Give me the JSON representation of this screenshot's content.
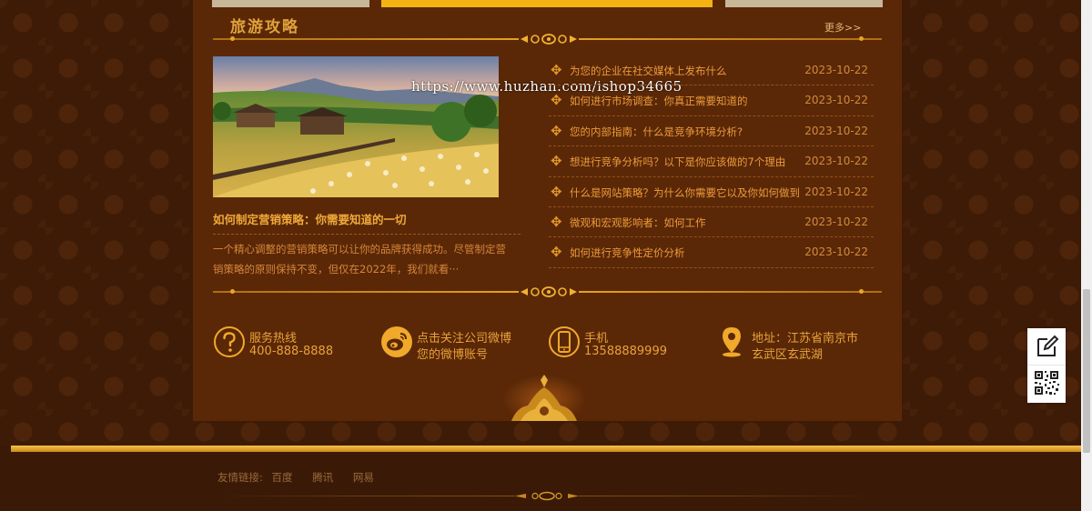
{
  "section": {
    "title": "旅游攻略",
    "more": "更多>>"
  },
  "featured": {
    "title": "如何制定营销策略：你需要知道的一切",
    "description": "一个精心调整的营销策略可以让你的品牌获得成功。尽管制定营销策略的原则保持不变，但仅在2022年，我们就看···",
    "watermark": "https://www.huzhan.com/ishop34665"
  },
  "news": [
    {
      "title": "为您的企业在社交媒体上发布什么",
      "date": "2023-10-22"
    },
    {
      "title": "如何进行市场调查：你真正需要知道的",
      "date": "2023-10-22"
    },
    {
      "title": "您的内部指南：什么是竞争环境分析?",
      "date": "2023-10-22"
    },
    {
      "title": "想进行竞争分析吗？以下是你应该做的7个理由",
      "date": "2023-10-22"
    },
    {
      "title": "什么是网站策略？为什么你需要它以及你如何做到",
      "date": "2023-10-22"
    },
    {
      "title": "微观和宏观影响者：如何工作",
      "date": "2023-10-22"
    },
    {
      "title": "如何进行竞争性定价分析",
      "date": "2023-10-22"
    }
  ],
  "contacts": [
    {
      "icon": "question-icon",
      "line1": "服务热线",
      "line2": "400-888-8888"
    },
    {
      "icon": "weibo-icon",
      "line1": "点击关注公司微博",
      "line2": "您的微博账号"
    },
    {
      "icon": "phone-icon",
      "line1": "手机",
      "line2": "13588889999"
    },
    {
      "icon": "location-pin-icon",
      "line1": "地址：江苏省南京市",
      "line2": "玄武区玄武湖"
    }
  ],
  "footer": {
    "links_label": "友情链接:",
    "links": [
      "百度",
      "腾讯",
      "网易"
    ]
  },
  "sidebar": {
    "buttons": [
      "edit-icon",
      "qrcode-icon"
    ]
  },
  "colors": {
    "panel": "#5a2807",
    "accent": "#e8a628",
    "text": "#ec9a3a"
  }
}
